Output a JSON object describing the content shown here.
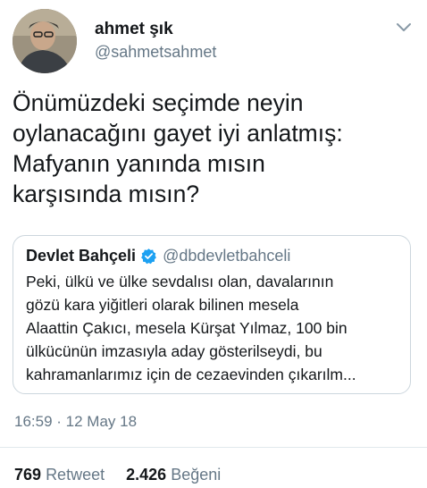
{
  "author": {
    "name": "ahmet şık",
    "handle": "@sahmetsahmet",
    "avatar_icon": "profile-photo"
  },
  "tweet_lines": [
    "Önümüzdeki seçimde neyin",
    "oylanacağını gayet iyi anlatmış:",
    "Mafyanın yanında mısın",
    "karşısında mısın?"
  ],
  "quoted_tweet": {
    "name": "Devlet Bahçeli",
    "verified_icon": "verified-badge-icon",
    "handle": "@dbdevletbahceli",
    "lines": [
      "Peki, ülkü ve ülke sevdalısı olan, davalarının",
      "gözü kara yiğitleri olarak bilinen mesela",
      "Alaattin Çakıcı, mesela Kürşat Yılmaz, 100 bin",
      "ülkücünün imzasıyla aday gösterilseydi, bu",
      "kahramanlarımız için de cezaevinden çıkarılm..."
    ]
  },
  "timestamp": "16:59 · 12 May 18",
  "stats": {
    "retweets": "769",
    "retweets_label": "Retweet",
    "likes": "2.426",
    "likes_label": "Beğeni"
  },
  "colors": {
    "text": "#14171a",
    "secondary": "#657786",
    "border": "#ccd6dd",
    "verified": "#1da1f2"
  }
}
